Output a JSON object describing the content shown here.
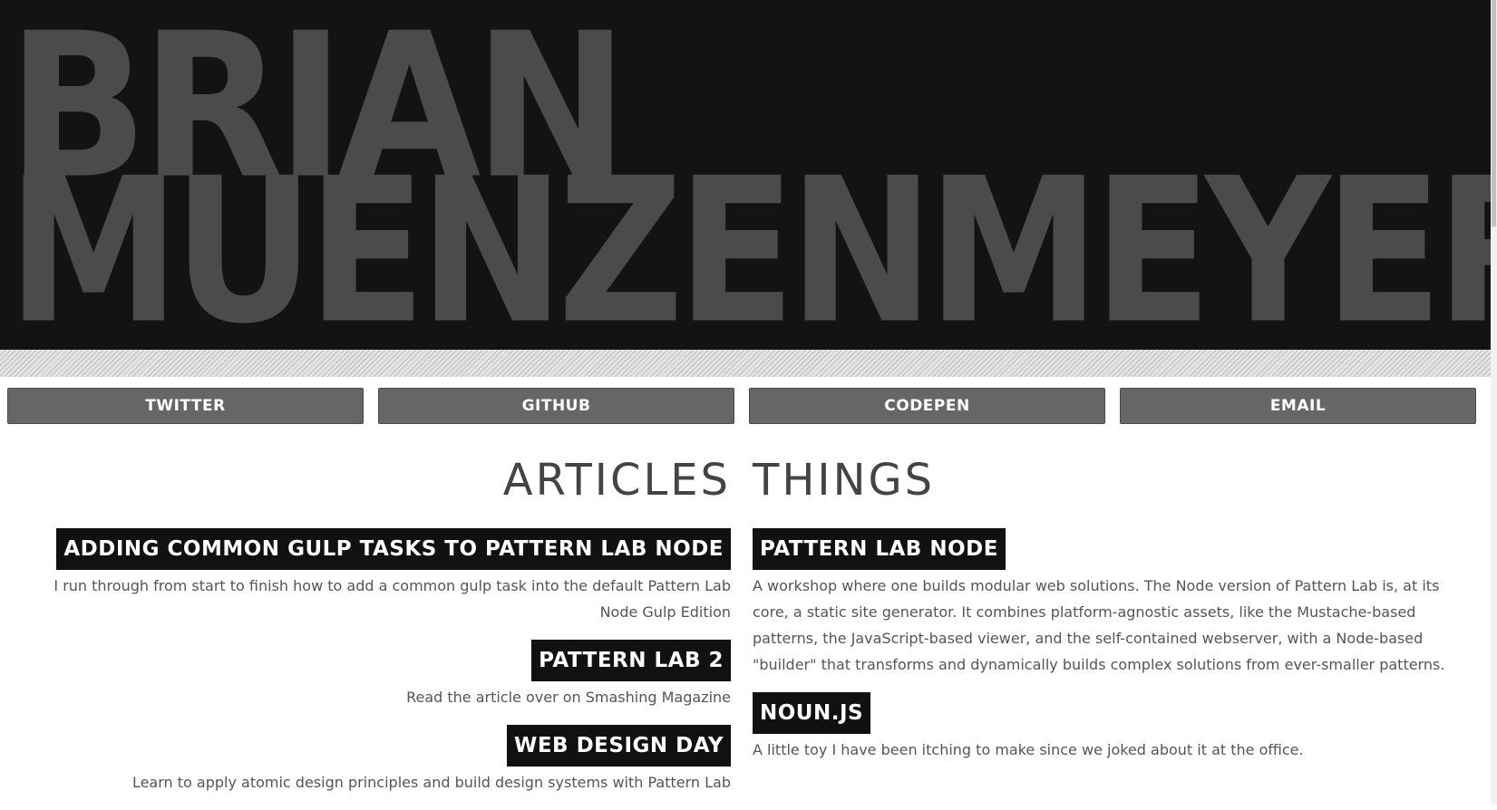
{
  "hero": {
    "line1": "BRIAN",
    "line2": "MUENZENMEYER"
  },
  "nav": [
    {
      "label": "TWITTER"
    },
    {
      "label": "GITHUB"
    },
    {
      "label": "CODEPEN"
    },
    {
      "label": "EMAIL"
    }
  ],
  "articles": {
    "heading": "ARTICLES",
    "items": [
      {
        "title": "ADDING COMMON GULP TASKS TO PATTERN LAB NODE",
        "description": "I run through from start to finish how to add a common gulp task into the default Pattern Lab Node Gulp Edition"
      },
      {
        "title": "PATTERN LAB 2",
        "description": "Read the article over on Smashing Magazine"
      },
      {
        "title": "WEB DESIGN DAY",
        "description": "Learn to apply atomic design principles and build design systems with Pattern Lab"
      }
    ]
  },
  "things": {
    "heading": "THINGS",
    "items": [
      {
        "title": "PATTERN LAB NODE",
        "description": "A workshop where one builds modular web solutions. The Node version of Pattern Lab is, at its core, a static site generator. It combines platform-agnostic assets, like the Mustache-based patterns, the JavaScript-based viewer, and the self-contained webserver, with a Node-based \"builder\" that transforms and dynamically builds complex solutions from ever-smaller patterns."
      },
      {
        "title": "NOUN.JS",
        "description": "A little toy I have been itching to make since we joked about it at the office."
      }
    ]
  },
  "colors": {
    "hero_bg": "#131313",
    "hero_text": "#4b4b4b",
    "nav_button": "#666666",
    "title_bg": "#111111",
    "body_text": "#555555"
  }
}
